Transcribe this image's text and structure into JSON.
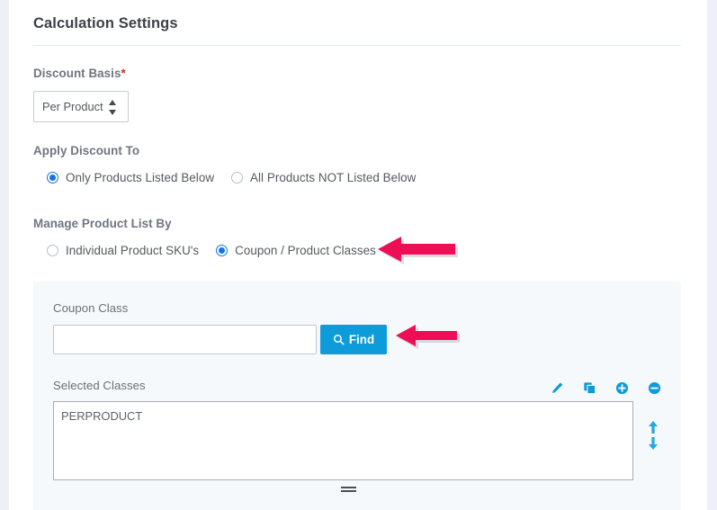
{
  "section": {
    "title": "Calculation Settings"
  },
  "discount_basis": {
    "label": "Discount Basis",
    "required_marker": "*",
    "selected_value": "Per Product",
    "options": [
      "Per Product"
    ]
  },
  "apply_discount_to": {
    "label": "Apply Discount To",
    "options": [
      {
        "label": "Only Products Listed Below",
        "selected": true
      },
      {
        "label": "All Products NOT Listed Below",
        "selected": false
      }
    ]
  },
  "manage_product_list_by": {
    "label": "Manage Product List By",
    "options": [
      {
        "label": "Individual Product SKU's",
        "selected": false
      },
      {
        "label": "Coupon / Product Classes",
        "selected": true
      }
    ]
  },
  "coupon_class_panel": {
    "search_label": "Coupon Class",
    "search_value": "",
    "search_placeholder": "",
    "find_button_label": "Find",
    "find_button_icon": "search-icon",
    "selected_classes_label": "Selected Classes",
    "selected_classes_value": "PERPRODUCT",
    "toolbar_icons": [
      {
        "name": "edit-pencil-icon",
        "title": "Edit"
      },
      {
        "name": "copy-icon",
        "title": "Copy"
      },
      {
        "name": "plus-circle-icon",
        "title": "Add"
      },
      {
        "name": "minus-circle-icon",
        "title": "Remove"
      }
    ],
    "order_icons": [
      {
        "name": "arrow-up-icon",
        "title": "Move Up"
      },
      {
        "name": "arrow-down-icon",
        "title": "Move Down"
      }
    ],
    "resize_handle": "textarea-resize-grip"
  },
  "annotations": [
    {
      "name": "annotation-arrow-coupon-classes",
      "points_to": "Coupon / Product Classes"
    },
    {
      "name": "annotation-arrow-find-button",
      "points_to": "Find"
    }
  ],
  "colors": {
    "accent_blue": "#0d9bd9",
    "radio_blue": "#1272e8",
    "annotation_pink": "#ed0e56",
    "panel_bg": "#f5f9fb",
    "page_bg": "#eef0f5",
    "label_gray": "#6f7680"
  }
}
